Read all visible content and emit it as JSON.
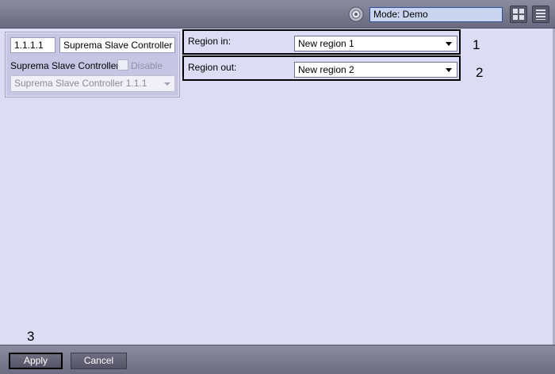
{
  "topbar": {
    "mode_text": "Mode: Demo",
    "mode_icon": "mode-gear-icon",
    "layout_icon": "layout-grid-icon",
    "menu_icon": "menu-list-icon"
  },
  "object": {
    "id": "1.1.1.1",
    "name": "Suprema Slave Controller Reader",
    "type_label": "Suprema Slave Controller",
    "disable_label": "Disable",
    "disabled": false,
    "parent_selected": "Suprema Slave Controller 1.1.1"
  },
  "regions": {
    "in_label": "Region in:",
    "in_value": "New region 1",
    "out_label": "Region out:",
    "out_value": "New region 2"
  },
  "callouts": {
    "one": "1",
    "two": "2",
    "three": "3"
  },
  "buttons": {
    "apply": "Apply",
    "cancel": "Cancel"
  },
  "colors": {
    "background": "#dcdcf5",
    "bar": "#7a7a90",
    "mode_field": "#c8d4f0"
  }
}
